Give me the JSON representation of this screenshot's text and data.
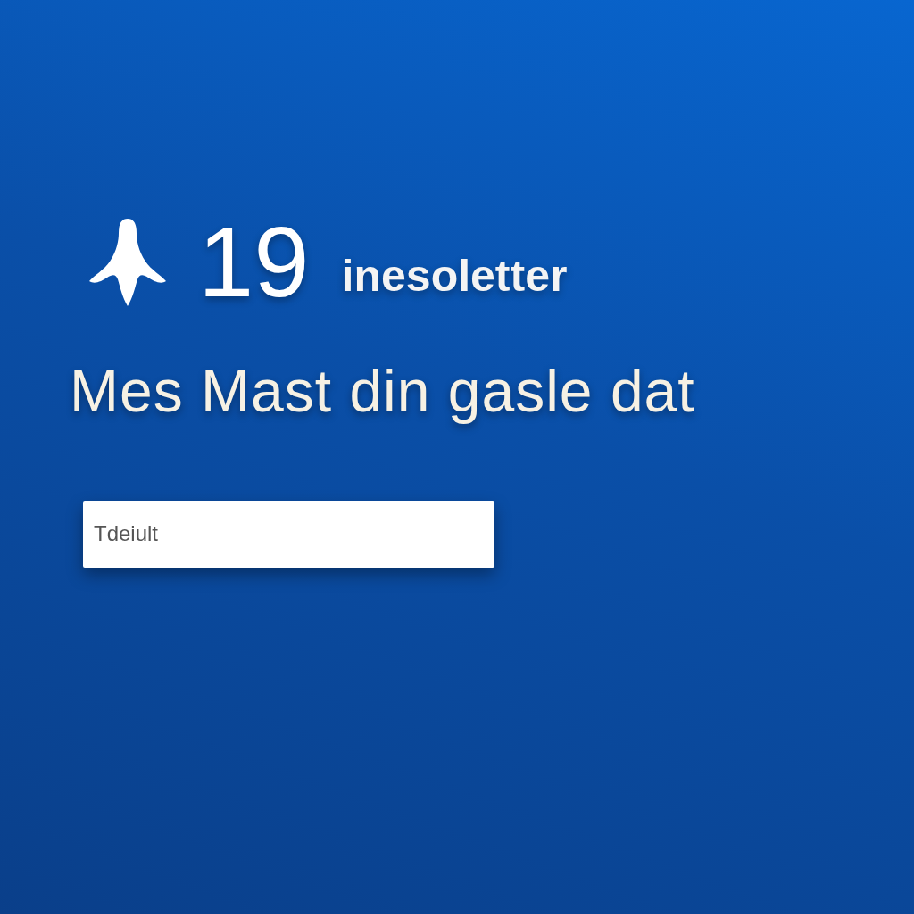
{
  "header": {
    "number": "19",
    "word": "inesoletter"
  },
  "headline": "Mes Mast din gasle dat",
  "search": {
    "placeholder": "Tdeiult"
  }
}
